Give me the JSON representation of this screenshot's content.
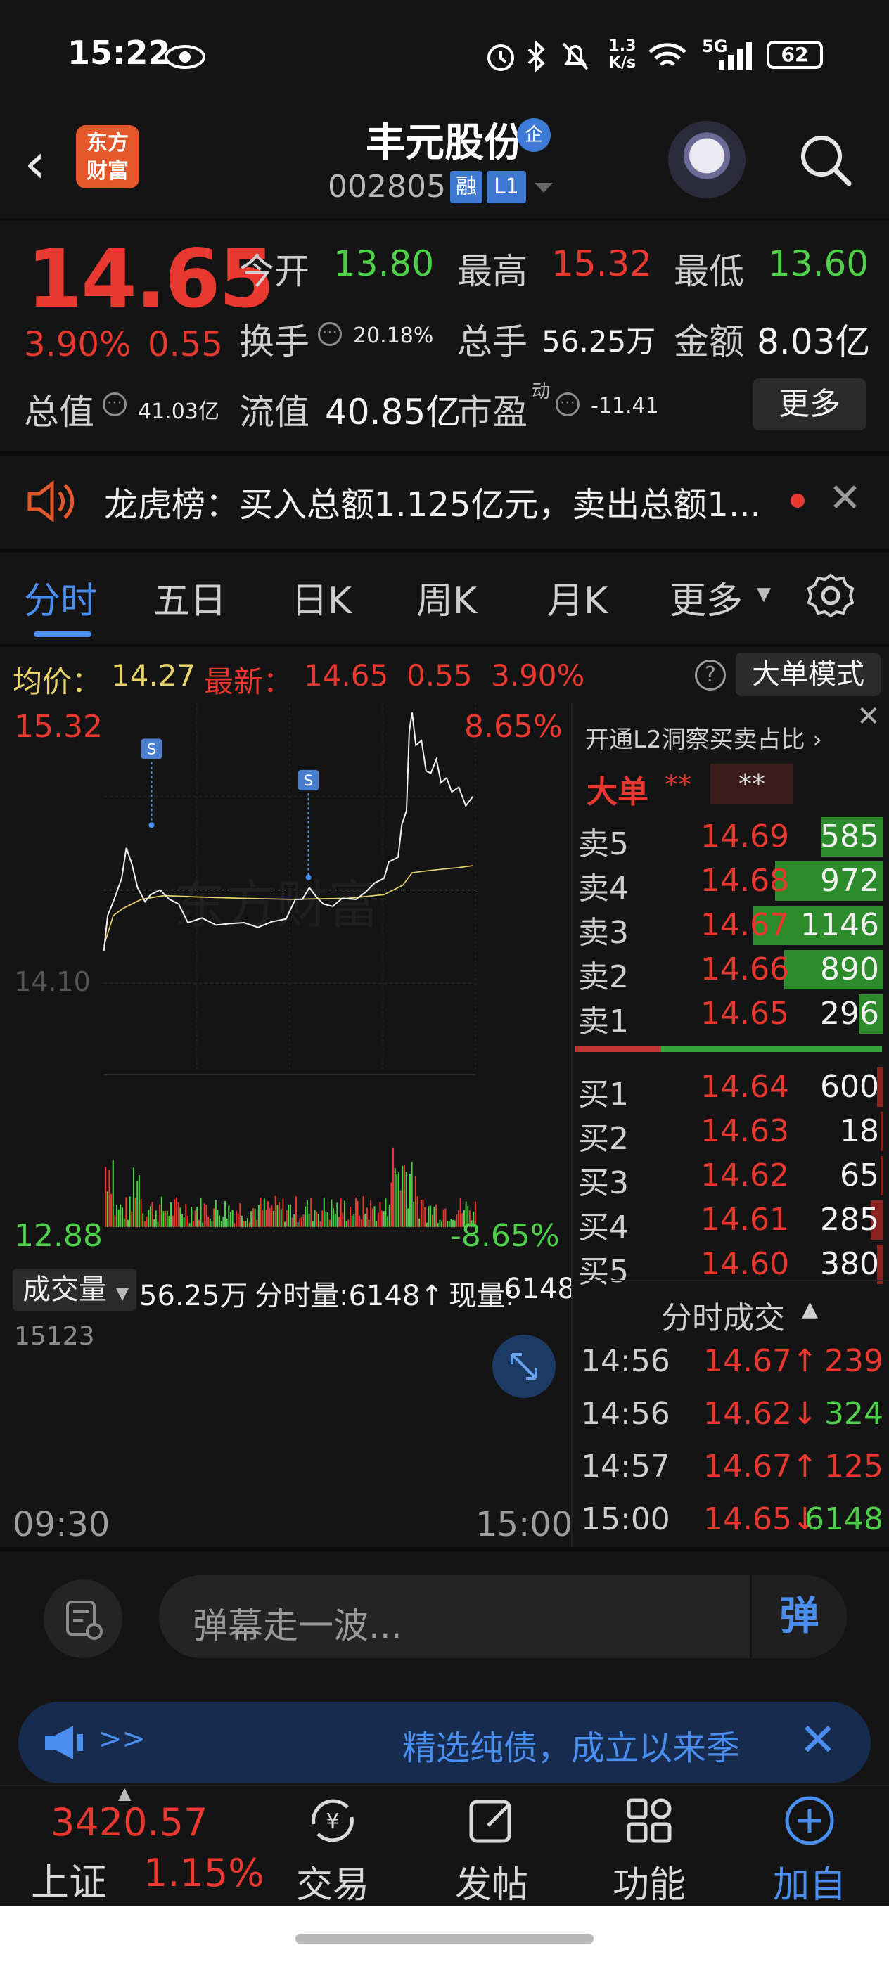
{
  "status_bar": {
    "time": "15:22",
    "net_speed_top": "1.3",
    "net_speed_bottom": "K/s",
    "battery": "62",
    "signal": "5G"
  },
  "header": {
    "logo_top": "东方",
    "logo_bottom": "财富",
    "stock_name": "丰元股份",
    "badge": "企",
    "code": "002805",
    "tag1": "融",
    "tag2": "L1"
  },
  "quote": {
    "price": "14.65",
    "pct": "3.90%",
    "change": "0.55",
    "open_label": "今开",
    "open": "13.80",
    "high_label": "最高",
    "high": "15.32",
    "low_label": "最低",
    "low": "13.60",
    "turnover_label": "换手",
    "turnover": "20.18%",
    "volume_label": "总手",
    "volume": "56.25万",
    "amount_label": "金额",
    "amount": "8.03亿",
    "mktcap_label": "总值",
    "mktcap": "41.03亿",
    "float_label": "流值",
    "float_cap": "40.85亿",
    "pe_label": "市盈",
    "pe_sup": "动",
    "pe": "-11.41",
    "more_button": "更多"
  },
  "ticker": {
    "text": "龙虎榜：买入总额1.125亿元，卖出总额1..."
  },
  "tabs": [
    {
      "label": "分时"
    },
    {
      "label": "五日"
    },
    {
      "label": "日K"
    },
    {
      "label": "周K"
    },
    {
      "label": "月K"
    },
    {
      "label": "更多"
    }
  ],
  "info_line": {
    "avg_label": "均价：",
    "avg": "14.27",
    "last_label": "最新：",
    "last": "14.65",
    "chg": "0.55",
    "pct": "3.90%",
    "mode_button": "大单模式"
  },
  "chart": {
    "axis_top_left": "15.32",
    "axis_top_right": "8.65%",
    "axis_bottom_left": "12.88",
    "axis_bottom_right": "-8.65%",
    "midline_label": "14.10",
    "watermark": "东方财富",
    "s_marker": "S",
    "volume_dropdown": "成交量",
    "volume_total": "56.25万",
    "tick_volume_label": "分时量:6148↑",
    "current_volume_label": "现量:",
    "current_volume": "6148",
    "volume_max": "15123",
    "time_start": "09:30",
    "time_end": "15:00"
  },
  "chart_data": {
    "type": "line",
    "ylim": [
      12.88,
      15.32
    ],
    "series": [],
    "volume": [],
    "colors": {
      "price": "#f2f2f2",
      "avg": "#e7d36a",
      "up": "#e8382f",
      "down": "#4fd04a"
    }
  },
  "orderbook": {
    "l2_text": "开通L2洞察买卖占比 ›",
    "big_order_label": "大单",
    "big_order_stars": "**",
    "big_order_stars2": "**",
    "asks": [
      {
        "name": "卖5",
        "price": "14.69",
        "vol": "585",
        "fill": 0.2
      },
      {
        "name": "卖4",
        "price": "14.68",
        "vol": "972",
        "fill": 0.35
      },
      {
        "name": "卖3",
        "price": "14.67",
        "vol": "1146",
        "fill": 0.42
      },
      {
        "name": "卖2",
        "price": "14.66",
        "vol": "890",
        "fill": 0.32
      },
      {
        "name": "卖1",
        "price": "14.65",
        "vol": "296",
        "fill": 0.08
      }
    ],
    "bids": [
      {
        "name": "买1",
        "price": "14.64",
        "vol": "600",
        "fill": 0.02
      },
      {
        "name": "买2",
        "price": "14.63",
        "vol": "18",
        "fill": 0.01
      },
      {
        "name": "买3",
        "price": "14.62",
        "vol": "65",
        "fill": 0.01
      },
      {
        "name": "买4",
        "price": "14.61",
        "vol": "285",
        "fill": 0.04
      },
      {
        "name": "买5",
        "price": "14.60",
        "vol": "380",
        "fill": 0.02
      }
    ]
  },
  "ticks": {
    "title": "分时成交",
    "rows": [
      {
        "time": "14:56",
        "price": "14.67↑",
        "vol": "239",
        "dir": "up"
      },
      {
        "time": "14:56",
        "price": "14.62↓",
        "vol": "324",
        "dir": "down"
      },
      {
        "time": "14:57",
        "price": "14.67↑",
        "vol": "125",
        "dir": "up"
      },
      {
        "time": "15:00",
        "price": "14.65↓",
        "vol": "6148",
        "dir": "down"
      }
    ]
  },
  "comment": {
    "placeholder": "弹幕走一波...",
    "dan_button": "弹"
  },
  "promo": {
    "arrows": ">>",
    "text": "精选纯债，成立以来季"
  },
  "bottom_nav": {
    "index_value": "3420.57",
    "index_name": "上证",
    "index_pct": "1.15%",
    "items": [
      {
        "label": "交易"
      },
      {
        "label": "发帖"
      },
      {
        "label": "功能"
      },
      {
        "label": "加自选"
      }
    ]
  }
}
